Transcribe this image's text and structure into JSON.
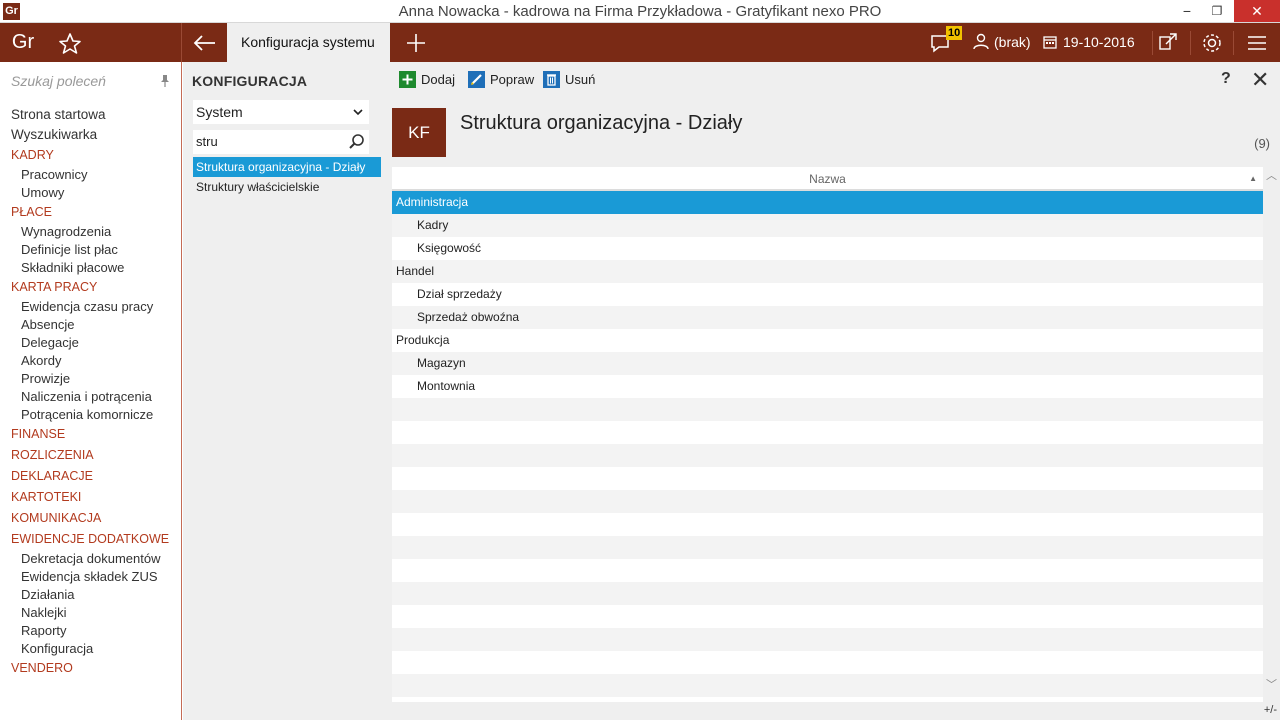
{
  "window": {
    "app_icon": "Gr",
    "title": "Anna Nowacka - kadrowa na Firma Przykładowa - Gratyfikant nexo PRO",
    "minimize": "−",
    "restore": "❐",
    "close": "✕"
  },
  "appbar": {
    "logo": "Gr",
    "tab_label": "Konfiguracja systemu",
    "notification_count": "10",
    "user_label": "(brak)",
    "date": "19-10-2016",
    "colors": {
      "brand": "#7a2a15",
      "selection": "#1a9ad6"
    }
  },
  "leftnav": {
    "search_placeholder": "Szukaj poleceń",
    "pin_icon": "📌",
    "items": [
      {
        "label": "Strona startowa",
        "kind": "top"
      },
      {
        "label": "Wyszukiwarka",
        "kind": "top"
      },
      {
        "label": "KADRY",
        "kind": "section"
      },
      {
        "label": "Pracownicy",
        "kind": "sub"
      },
      {
        "label": "Umowy",
        "kind": "sub"
      },
      {
        "label": "PŁACE",
        "kind": "section"
      },
      {
        "label": "Wynagrodzenia",
        "kind": "sub"
      },
      {
        "label": "Definicje list płac",
        "kind": "sub"
      },
      {
        "label": "Składniki płacowe",
        "kind": "sub"
      },
      {
        "label": "KARTA PRACY",
        "kind": "section"
      },
      {
        "label": "Ewidencja czasu pracy",
        "kind": "sub"
      },
      {
        "label": "Absencje",
        "kind": "sub"
      },
      {
        "label": "Delegacje",
        "kind": "sub"
      },
      {
        "label": "Akordy",
        "kind": "sub"
      },
      {
        "label": "Prowizje",
        "kind": "sub"
      },
      {
        "label": "Naliczenia i potrącenia",
        "kind": "sub"
      },
      {
        "label": "Potrącenia komornicze",
        "kind": "sub"
      },
      {
        "label": "FINANSE",
        "kind": "section"
      },
      {
        "label": "ROZLICZENIA",
        "kind": "section"
      },
      {
        "label": "DEKLARACJE",
        "kind": "section"
      },
      {
        "label": "KARTOTEKI",
        "kind": "section"
      },
      {
        "label": "KOMUNIKACJA",
        "kind": "section"
      },
      {
        "label": "EWIDENCJE DODATKOWE",
        "kind": "section"
      },
      {
        "label": "Dekretacja dokumentów",
        "kind": "sub"
      },
      {
        "label": "Ewidencja składek ZUS",
        "kind": "sub"
      },
      {
        "label": "Działania",
        "kind": "sub"
      },
      {
        "label": "Naklejki",
        "kind": "sub"
      },
      {
        "label": "Raporty",
        "kind": "sub"
      },
      {
        "label": "Konfiguracja",
        "kind": "sub"
      },
      {
        "label": "VENDERO",
        "kind": "section"
      }
    ]
  },
  "config_panel": {
    "heading": "KONFIGURACJA",
    "select_value": "System",
    "search_value": "stru",
    "results": [
      {
        "label": "Struktura organizacyjna - Działy",
        "selected": true
      },
      {
        "label": "Struktury właścicielskie",
        "selected": false
      }
    ]
  },
  "toolbar": {
    "add_label": "Dodaj",
    "edit_label": "Popraw",
    "delete_label": "Usuń",
    "help_label": "?",
    "close_label": "✕"
  },
  "content": {
    "badge": "KF",
    "title": "Struktura organizacyjna - Działy",
    "count": "(9)",
    "column_header": "Nazwa",
    "sort_icon": "▲",
    "rows": [
      {
        "label": "Administracja",
        "level": 0,
        "selected": true
      },
      {
        "label": "Kadry",
        "level": 1,
        "selected": false
      },
      {
        "label": "Księgowość",
        "level": 1,
        "selected": false
      },
      {
        "label": "Handel",
        "level": 0,
        "selected": false
      },
      {
        "label": "Dział sprzedaży",
        "level": 1,
        "selected": false
      },
      {
        "label": "Sprzedaż obwoźna",
        "level": 1,
        "selected": false
      },
      {
        "label": "Produkcja",
        "level": 0,
        "selected": false
      },
      {
        "label": "Magazyn",
        "level": 1,
        "selected": false
      },
      {
        "label": "Montownia",
        "level": 1,
        "selected": false
      }
    ],
    "footer_toggle": "+/-"
  }
}
